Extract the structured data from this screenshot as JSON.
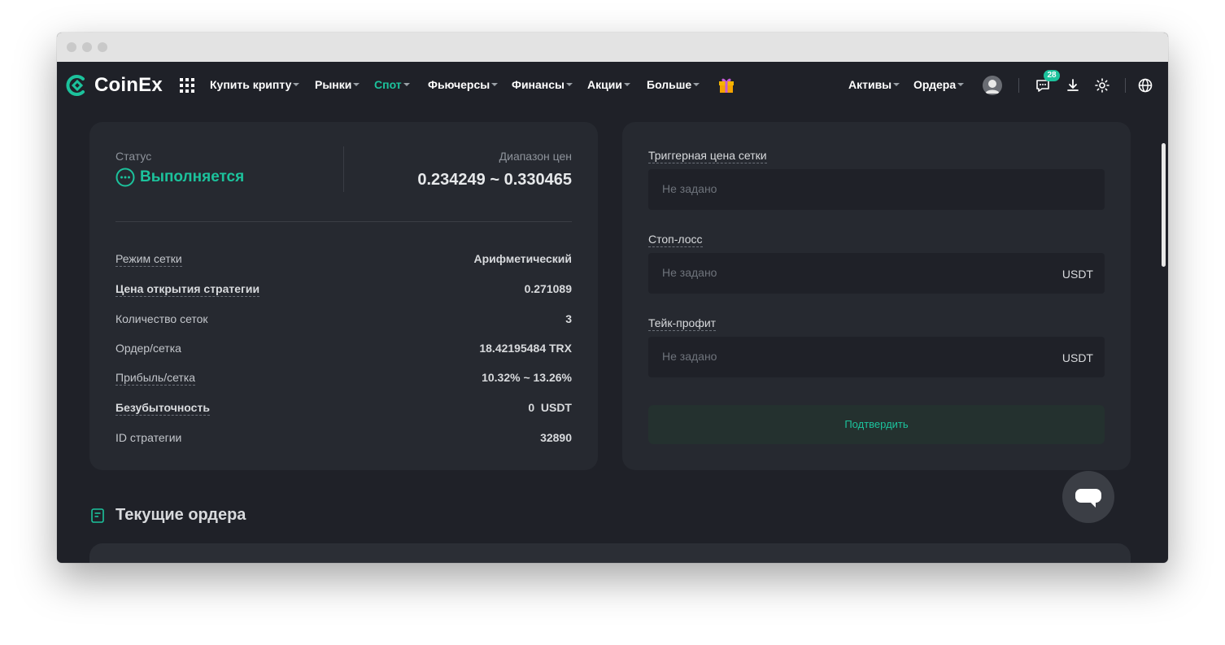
{
  "app": {
    "brand": "CoinEx",
    "accent_color": "#1cc29c",
    "background_color": "#1f2128"
  },
  "nav": {
    "items": [
      {
        "label": "Купить крипту",
        "active": false
      },
      {
        "label": "Рынки",
        "active": false
      },
      {
        "label": "Спот",
        "active": true
      },
      {
        "label": "Фьючерсы",
        "active": false
      },
      {
        "label": "Финансы",
        "active": false
      },
      {
        "label": "Акции",
        "active": false
      },
      {
        "label": "Больше",
        "active": false
      }
    ],
    "right": {
      "assets": "Активы",
      "orders": "Ордера"
    },
    "notification_count": "28",
    "icons": [
      "apps-grid-icon",
      "gift-icon",
      "avatar",
      "chat-icon",
      "download-icon",
      "theme-icon",
      "globe-icon"
    ]
  },
  "strategy": {
    "status_label": "Статус",
    "status_value": "Выполняется",
    "range_label": "Диапазон цен",
    "range_value": "0.234249 ~ 0.330465",
    "rows": [
      {
        "key": "Режим сетки",
        "value": "Арифметический"
      },
      {
        "key": "Цена открытия стратегии",
        "value": "0.271089"
      },
      {
        "key": "Количество сеток",
        "value": "3"
      },
      {
        "key": "Ордер/сетка",
        "value": "18.42195484 TRX"
      },
      {
        "key": "Прибыль/сетка",
        "value": "10.32% ~ 13.26%"
      },
      {
        "key": "Безубыточность",
        "value": "0  USDT"
      },
      {
        "key": "ID стратегии",
        "value": "32890"
      }
    ]
  },
  "settings": {
    "trigger_label": "Триггерная цена сетки",
    "trigger_placeholder": "Не задано",
    "stop_loss_label": "Стоп-лосс",
    "stop_loss_placeholder": "Не задано",
    "stop_loss_unit": "USDT",
    "take_profit_label": "Тейк-профит",
    "take_profit_placeholder": "Не задано",
    "take_profit_unit": "USDT",
    "confirm_label": "Подтвердить"
  },
  "orders_section": {
    "title": "Текущие ордера"
  }
}
